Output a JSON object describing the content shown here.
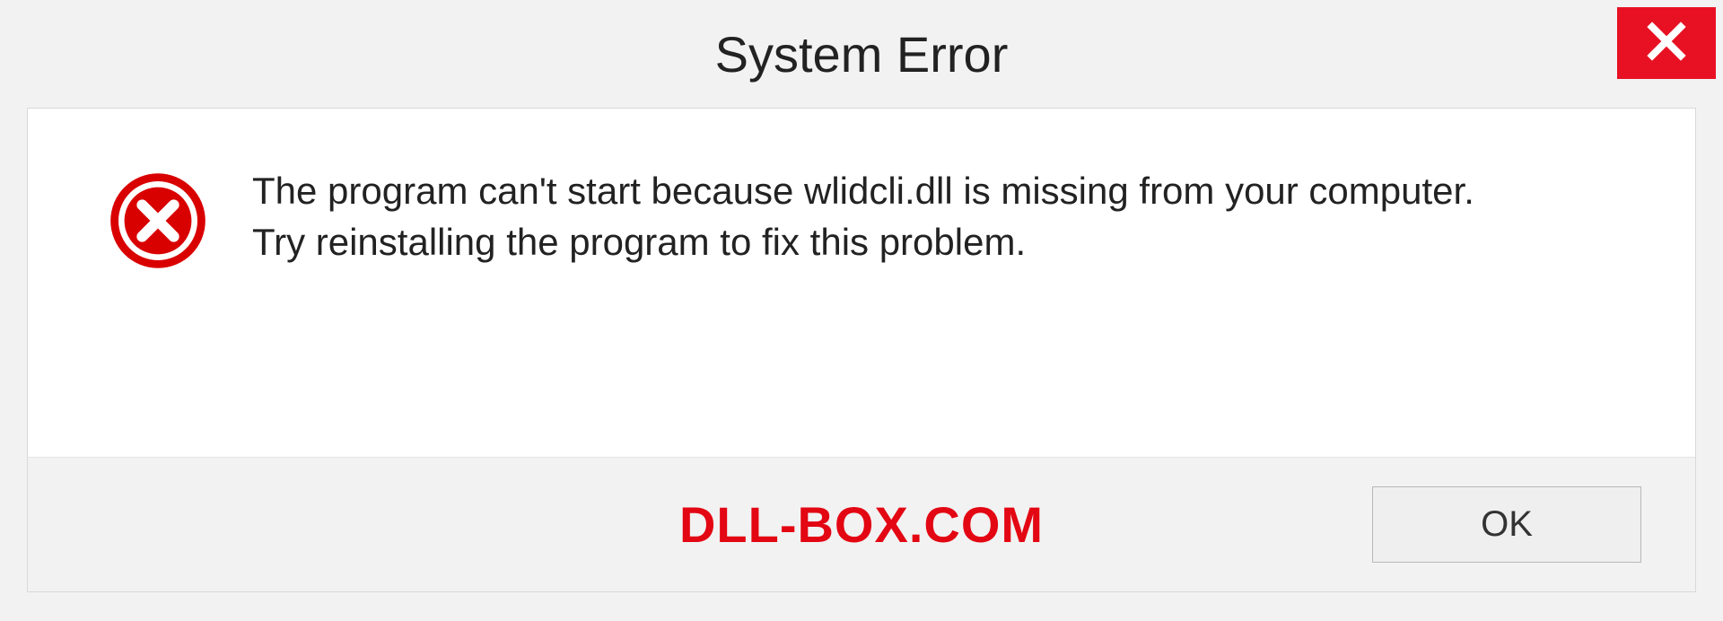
{
  "title": "System Error",
  "message": {
    "line1": "The program can't start because wlidcli.dll is missing from your computer.",
    "line2": "Try reinstalling the program to fix this problem."
  },
  "footer": {
    "brand": "DLL-BOX.COM",
    "ok": "OK"
  },
  "colors": {
    "accent_red": "#e81123",
    "brand_red": "#e30613"
  }
}
